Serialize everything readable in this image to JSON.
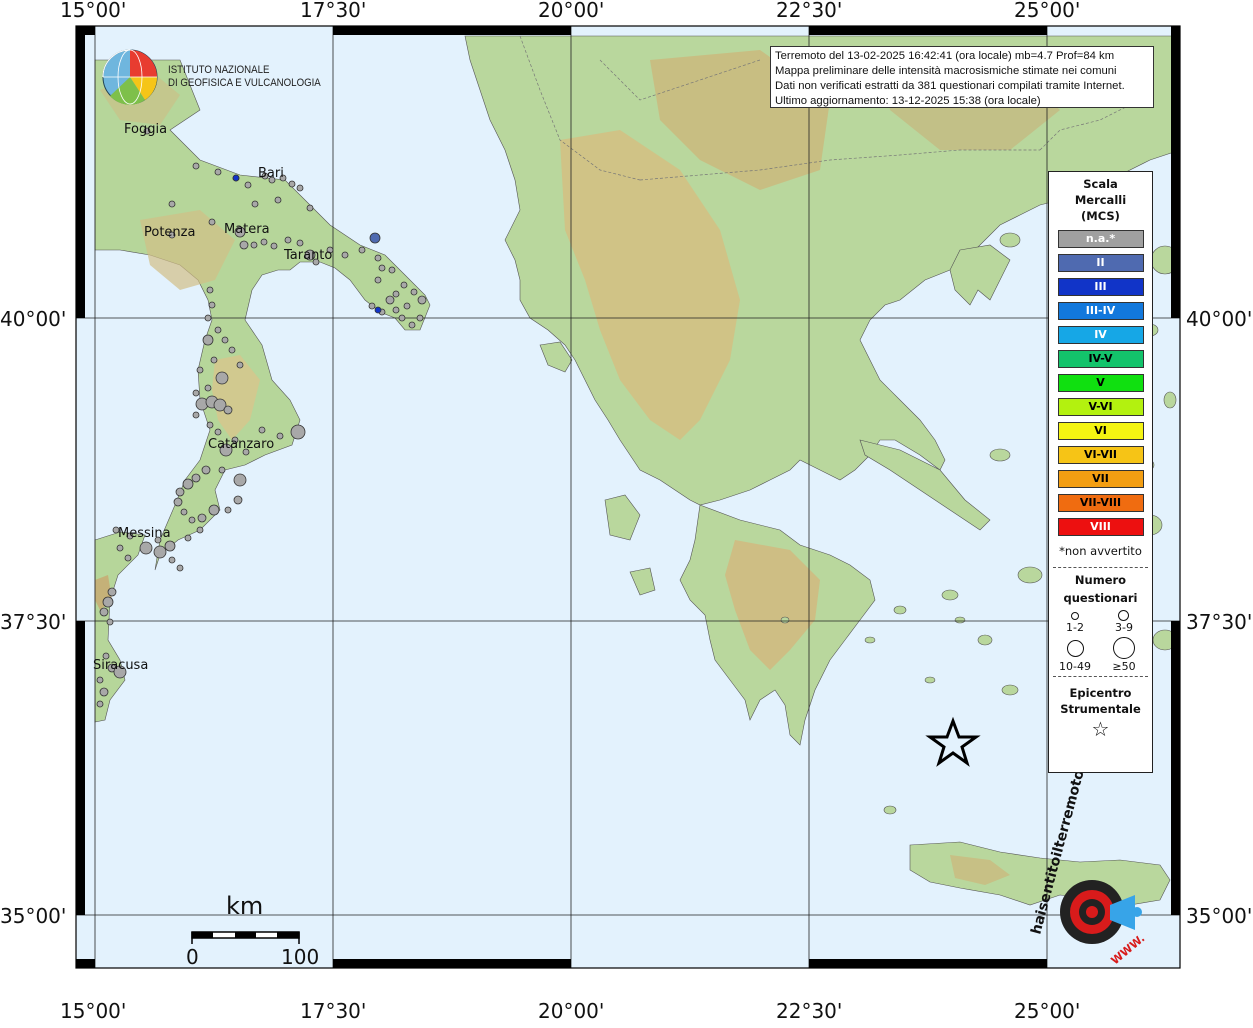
{
  "info": {
    "line1": "Terremoto del 13-02-2025 16:42:41 (ora locale) mb=4.7 Prof=84 km",
    "line2": "Mappa preliminare delle intensità macrosismiche stimate nei comuni",
    "line3": "Dati non verificati estratti da 381 questionari compilati tramite Internet.",
    "line4": "Ultimo aggiornamento: 13-12-2025 15:38 (ora locale)"
  },
  "logo": {
    "line1": "ISTITUTO NAZIONALE",
    "line2": "DI GEOFISICA E VULCANOLOGIA"
  },
  "axis": {
    "top": [
      "15°00'",
      "17°30'",
      "20°00'",
      "22°30'",
      "25°00'"
    ],
    "bottom": [
      "15°00'",
      "17°30'",
      "20°00'",
      "22°30'",
      "25°00'"
    ],
    "left": [
      "40°00'",
      "37°30'",
      "35°00'"
    ],
    "right": [
      "40°00'",
      "37°30'",
      "35°00'"
    ]
  },
  "cities": [
    "Foggia",
    "Bari",
    "Potenza",
    "Matera",
    "Taranto",
    "Catanzaro",
    "Messina",
    "Siracusa"
  ],
  "scalebar": {
    "unit": "km",
    "min": "0",
    "max": "100"
  },
  "legend": {
    "title1": "Scala",
    "title2": "Mercalli",
    "title3": "(MCS)",
    "classes": [
      {
        "label": "n.a.*",
        "color": "#a0a0a0",
        "text": "#ffffff"
      },
      {
        "label": "II",
        "color": "#4f6ab0",
        "text": "#ffffff"
      },
      {
        "label": "III",
        "color": "#1134c8",
        "text": "#ffffff"
      },
      {
        "label": "III-IV",
        "color": "#1278dc",
        "text": "#ffffff"
      },
      {
        "label": "IV",
        "color": "#16a7e6",
        "text": "#ffffff"
      },
      {
        "label": "IV-V",
        "color": "#13c36b",
        "text": "#000000"
      },
      {
        "label": "V",
        "color": "#10e010",
        "text": "#000000"
      },
      {
        "label": "V-VI",
        "color": "#b3f10f",
        "text": "#000000"
      },
      {
        "label": "VI",
        "color": "#f4f412",
        "text": "#000000"
      },
      {
        "label": "VI-VII",
        "color": "#f6c416",
        "text": "#000000"
      },
      {
        "label": "VII",
        "color": "#f39e12",
        "text": "#000000"
      },
      {
        "label": "VII-VIII",
        "color": "#f06c10",
        "text": "#000000"
      },
      {
        "label": "VIII",
        "color": "#ed1010",
        "text": "#ffffff"
      }
    ],
    "note": "*non avvertito",
    "count_title1": "Numero",
    "count_title2": "questionari",
    "counts": [
      "1-2",
      "3-9",
      "10-49",
      "≥50"
    ],
    "epi_title1": "Epicentro",
    "epi_title2": "Strumentale",
    "epi_symbol": "☆"
  },
  "stamp": {
    "text": "haisentitoilterremoto.it",
    "url": "WWW."
  }
}
